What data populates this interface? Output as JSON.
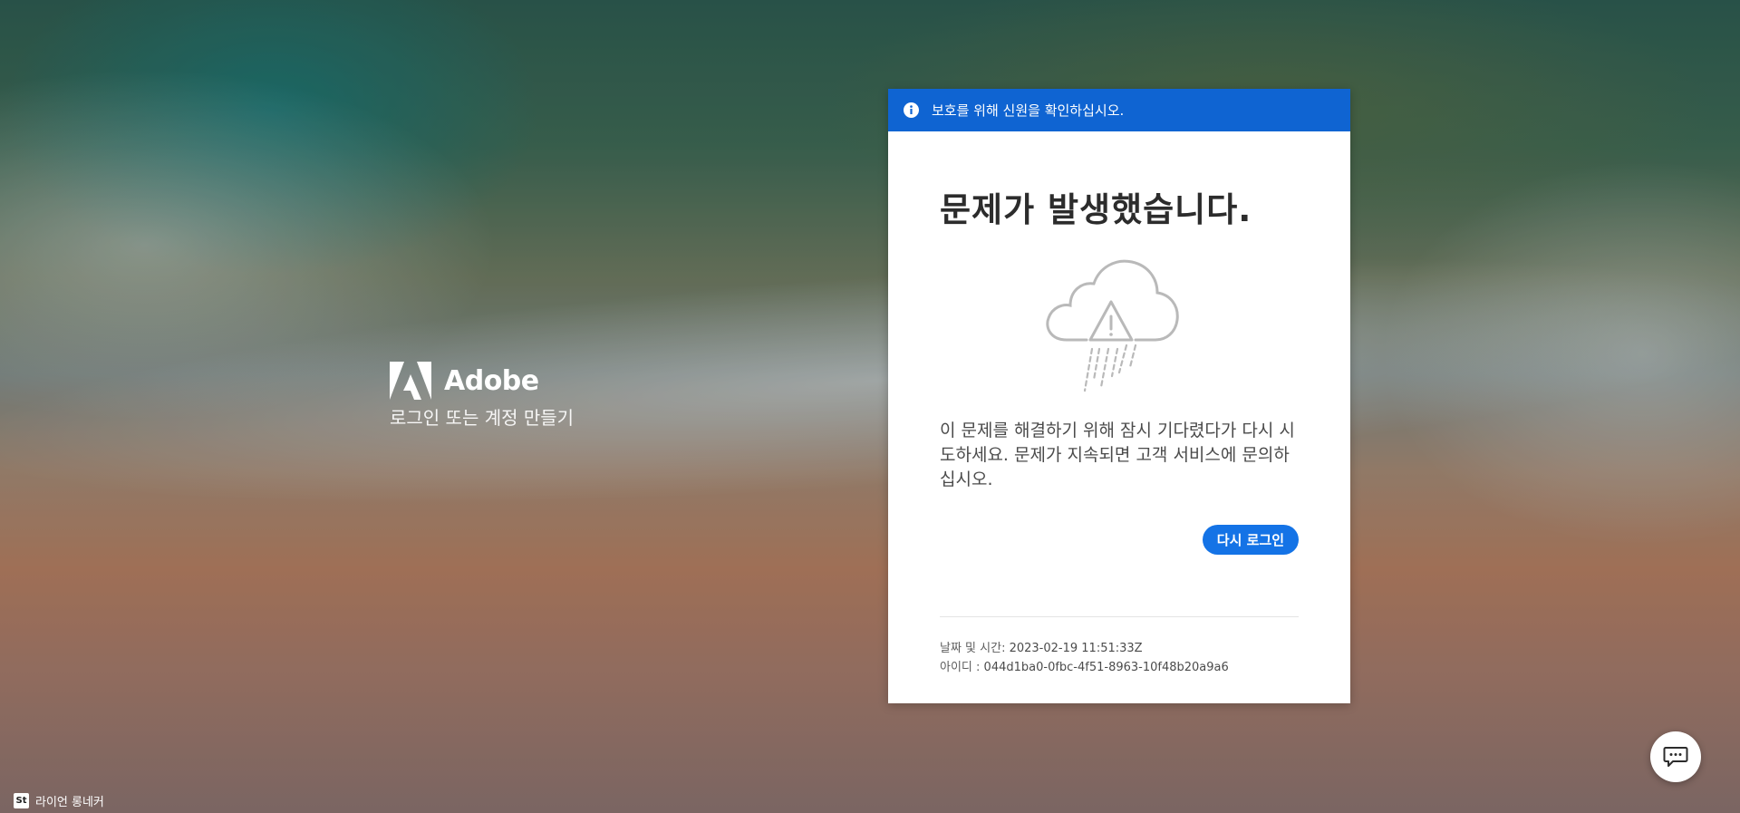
{
  "brand": {
    "name": "Adobe",
    "tagline": "로그인 또는 계정 만들기",
    "logo_icon": "adobe-logo-icon"
  },
  "card": {
    "banner_text": "보호를 위해 신원을 확인하십시오.",
    "banner_icon": "info-icon",
    "title": "문제가 발생했습니다.",
    "illustration": "cloud-warning-rain-icon",
    "message": "이 문제를 해결하기 위해 잠시 기다렸다가 다시 시도하세요. 문제가 지속되면 고객 서비스에 문의하십시오.",
    "retry_label": "다시 로그인",
    "meta": {
      "datetime_label": "날짜 및 시간:",
      "datetime_value": "2023-02-19 11:51:33Z",
      "id_label": "아이디 :",
      "id_value": "044d1ba0-0fbc-4f51-8963-10f48b20a9a6"
    }
  },
  "chat": {
    "icon": "chat-bubble-icon"
  },
  "credit": {
    "badge": "St",
    "text": "라이언 롱네커"
  },
  "colors": {
    "banner": "#0f64d2",
    "button": "#1473e6",
    "title": "#2c2c2c",
    "text": "#4b4b4b"
  }
}
